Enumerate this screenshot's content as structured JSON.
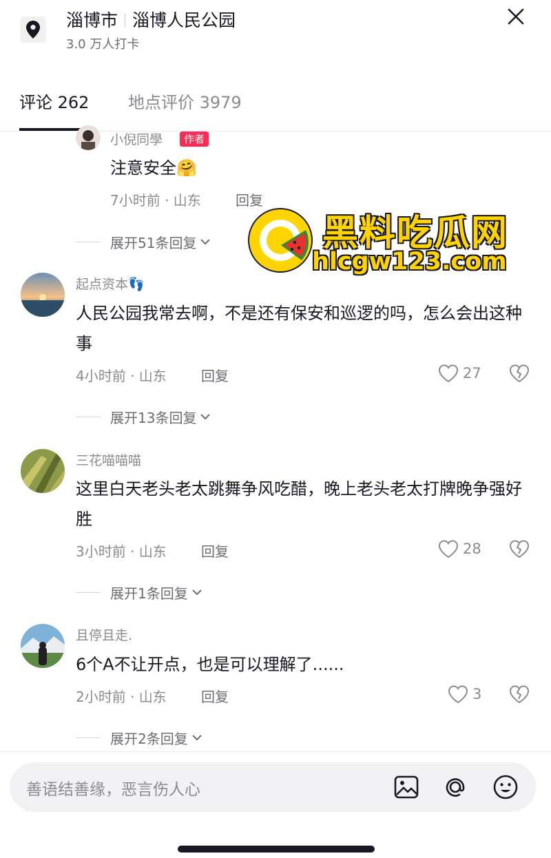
{
  "header": {
    "city": "淄博市",
    "place": "淄博人民公园",
    "checkins": "3.0 万人打卡"
  },
  "tabs": [
    {
      "label": "评论 262"
    },
    {
      "label": "地点评价 3979"
    }
  ],
  "reply_label": "回复",
  "comments": [
    {
      "username": "小倪同學",
      "badge": "作者",
      "text": "注意安全🤗",
      "meta": "7小时前 · 山东",
      "expand": "展开51条回复"
    },
    {
      "username": "起点资本👣",
      "text": "人民公园我常去啊，不是还有保安和巡逻的吗，怎么会出这种事",
      "meta": "4小时前 · 山东",
      "likes": "27",
      "expand": "展开13条回复"
    },
    {
      "username": "三花喵喵喵",
      "text": "这里白天老头老太跳舞争风吃醋，晚上老头老太打牌晚争强好胜",
      "meta": "3小时前 · 山东",
      "likes": "28",
      "expand": "展开1条回复"
    },
    {
      "username": "且停且走.",
      "text": "6个A不让开点，也是可以理解了......",
      "meta": "2小时前 · 山东",
      "likes": "3",
      "expand": "展开2条回复"
    }
  ],
  "watermark": {
    "name": "黑料吃瓜网",
    "url": "hlcgw123.com"
  },
  "input": {
    "placeholder": "善语结善缘，恶言伤人心"
  },
  "colors": {
    "accent_badge": "#fe2c55",
    "text_primary": "#161823",
    "text_secondary": "#8a8b91",
    "watermark_yellow": "#ffd400"
  },
  "icons": [
    "location-pin-icon",
    "close-icon",
    "heart-icon",
    "broken-heart-icon",
    "chevron-down-icon",
    "image-icon",
    "at-icon",
    "emoji-icon"
  ]
}
